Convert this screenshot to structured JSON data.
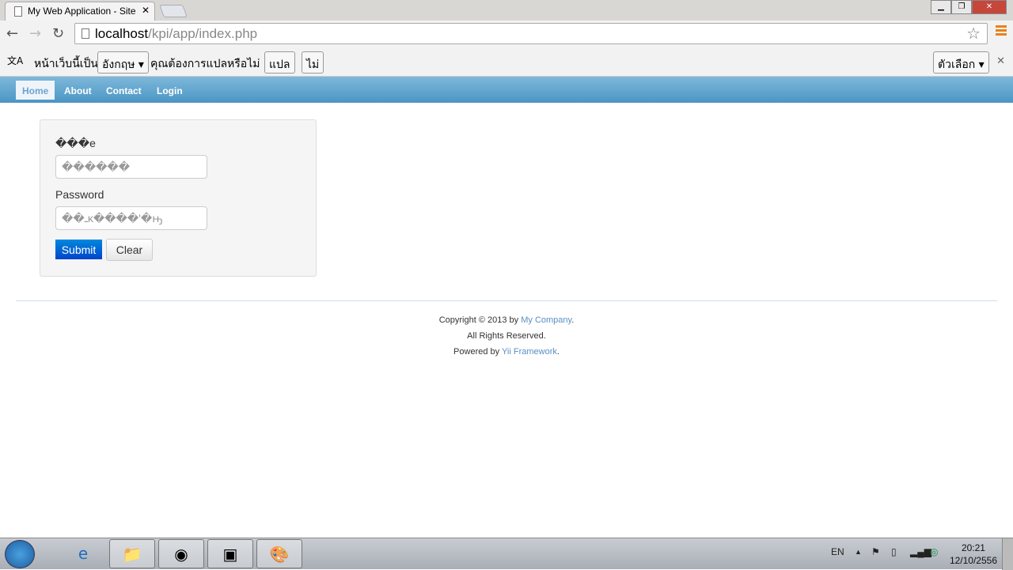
{
  "browser": {
    "tab_title": "My Web Application - Site",
    "url_host": "localhost",
    "url_path": "/kpi/app/index.php"
  },
  "translate_bar": {
    "text1": "หน้าเว็บนี้เป็น",
    "language": "อังกฤษ ▾",
    "text2": "คุณต้องการแปลหรือไม่",
    "translate": "แปล",
    "no": "ไม่",
    "options": "ตัวเลือก ▾"
  },
  "menu": [
    {
      "label": "Home"
    },
    {
      "label": "About"
    },
    {
      "label": "Contact"
    },
    {
      "label": "Login"
    }
  ],
  "form": {
    "username_label": "���e",
    "username_placeholder": "������",
    "password_label": "Password",
    "password_placeholder": "��ـĸ����ʹ�ԣ",
    "submit": "Submit",
    "clear": "Clear"
  },
  "footer": {
    "line1a": "Copyright © 2013 by ",
    "line1b": "My Company",
    "line1c": ".",
    "line2": "All Rights Reserved.",
    "line3a": "Powered by ",
    "line3b": "Yii Framework",
    "line3c": "."
  },
  "taskbar": {
    "lang": "EN",
    "time": "20:21",
    "date": "12/10/2556"
  }
}
